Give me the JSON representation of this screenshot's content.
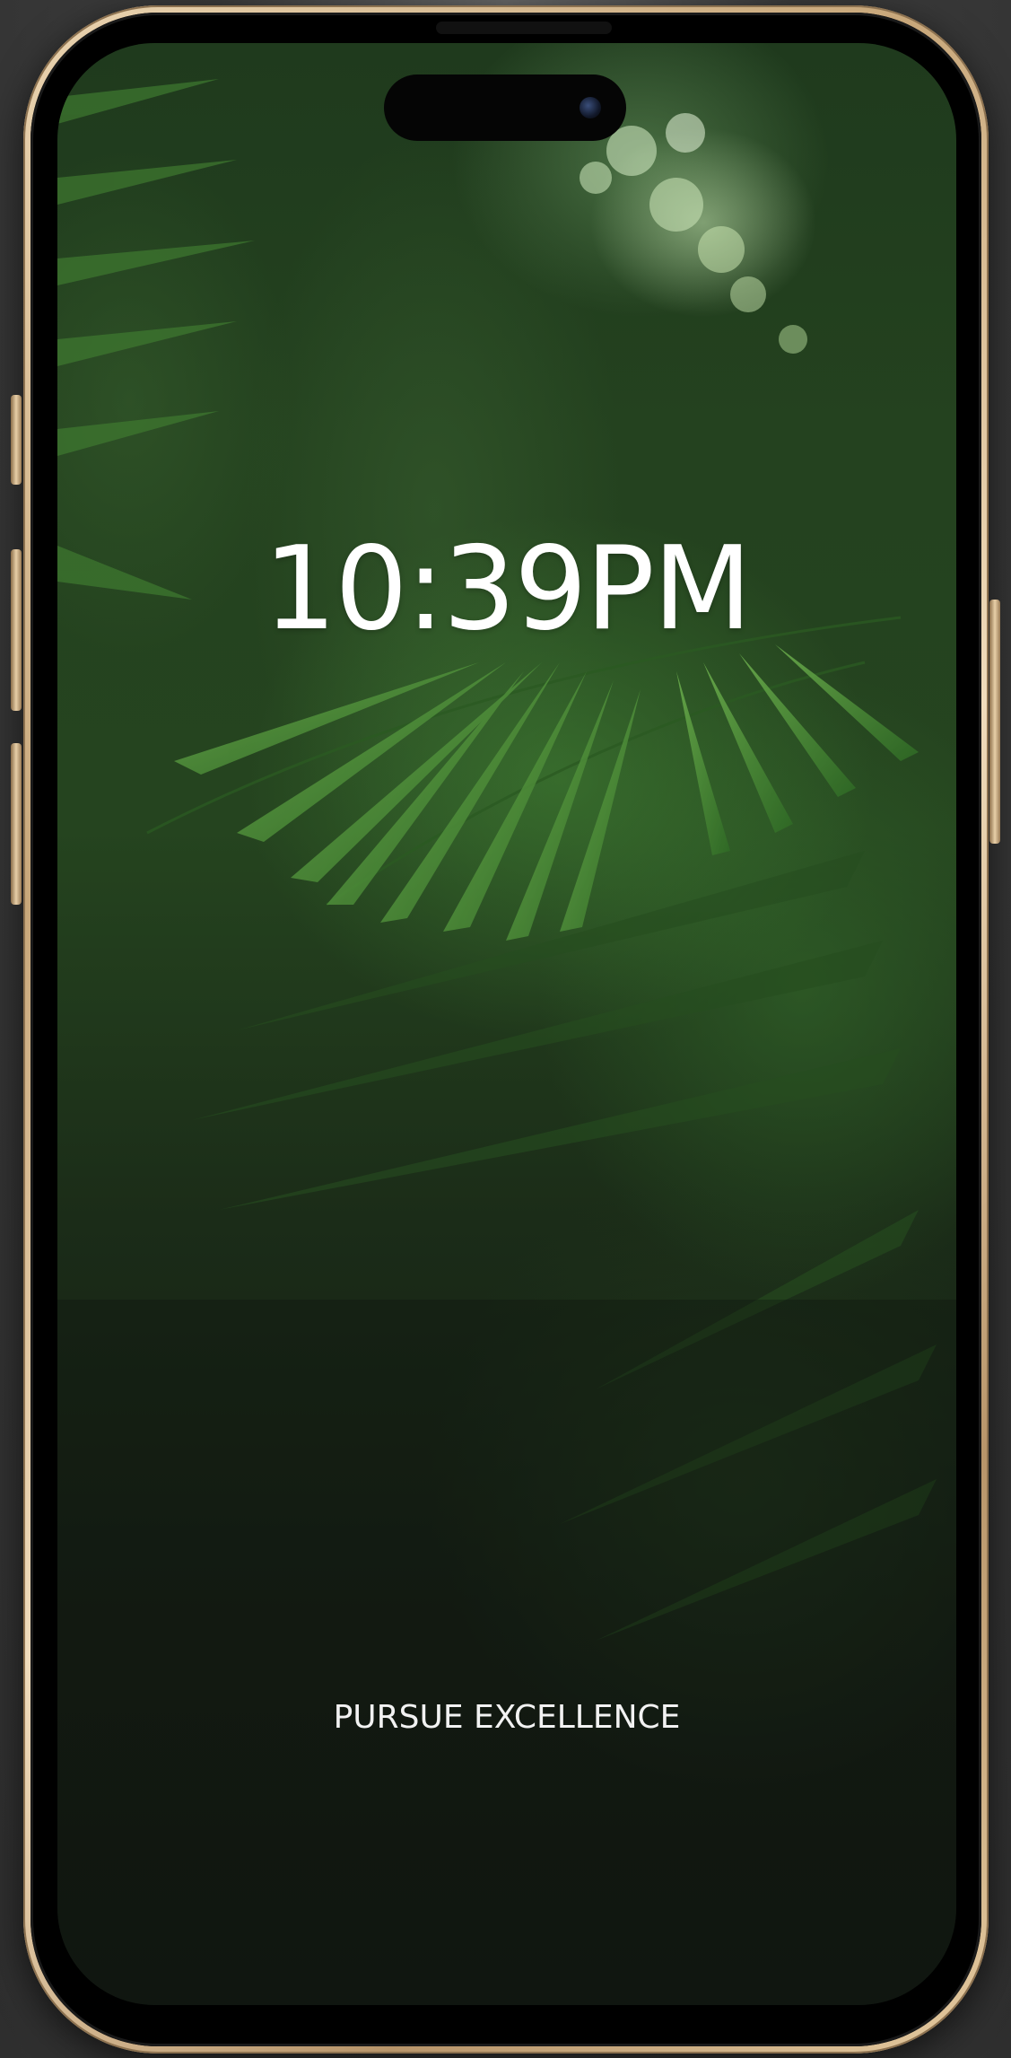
{
  "lock_screen": {
    "time": "10:39PM",
    "motto": "PURSUE EXCELLENCE"
  },
  "wallpaper": {
    "subject": "fern-leaves",
    "colors": {
      "deep": "#121812",
      "leaf": "#4e8f3a",
      "highlight": "#bfe0a8"
    }
  },
  "device": {
    "frame_color": "#d9bc8f"
  }
}
